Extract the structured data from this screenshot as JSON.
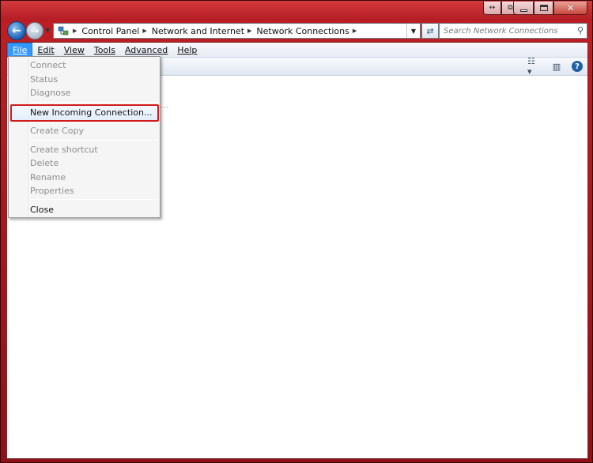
{
  "window": {
    "breadcrumb": [
      "Control Panel",
      "Network and Internet",
      "Network Connections"
    ],
    "search_placeholder": "Search Network Connections"
  },
  "menubar": {
    "items": [
      "File",
      "Edit",
      "View",
      "Tools",
      "Advanced",
      "Help"
    ],
    "active": "File"
  },
  "file_menu": {
    "items": [
      {
        "label": "Connect",
        "enabled": false
      },
      {
        "label": "Status",
        "enabled": false
      },
      {
        "label": "Diagnose",
        "enabled": false
      },
      {
        "label": "New Incoming Connection...",
        "enabled": true,
        "highlighted": true
      },
      {
        "label": "Create Copy",
        "enabled": false
      },
      {
        "label": "Create shortcut",
        "enabled": false
      },
      {
        "label": "Delete",
        "enabled": false
      },
      {
        "label": "Rename",
        "enabled": false
      },
      {
        "label": "Properties",
        "enabled": false
      },
      {
        "label": "Close",
        "enabled": true
      }
    ]
  },
  "theme": {
    "frame_color": "#b21b22",
    "menu_active_color": "#3399ff",
    "highlight_border": "#d21b1b"
  },
  "icons": {
    "back": "back-arrow-icon",
    "forward": "forward-arrow-icon",
    "refresh": "refresh-icon",
    "search": "search-icon",
    "views": "views-icon",
    "preview_pane": "preview-pane-icon",
    "help": "help-icon"
  }
}
